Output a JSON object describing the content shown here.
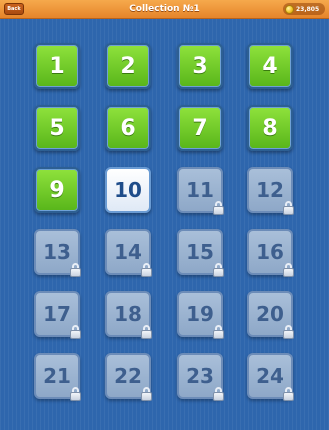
{
  "header": {
    "back_label": "Back",
    "title": "Collection №1",
    "coins": "23,805",
    "coin_icon": "coin-icon"
  },
  "levels": [
    {
      "number": "1",
      "state": "unlocked"
    },
    {
      "number": "2",
      "state": "unlocked"
    },
    {
      "number": "3",
      "state": "unlocked"
    },
    {
      "number": "4",
      "state": "unlocked"
    },
    {
      "number": "5",
      "state": "unlocked"
    },
    {
      "number": "6",
      "state": "unlocked"
    },
    {
      "number": "7",
      "state": "unlocked"
    },
    {
      "number": "8",
      "state": "unlocked"
    },
    {
      "number": "9",
      "state": "unlocked"
    },
    {
      "number": "10",
      "state": "current"
    },
    {
      "number": "11",
      "state": "locked"
    },
    {
      "number": "12",
      "state": "locked"
    },
    {
      "number": "13",
      "state": "locked"
    },
    {
      "number": "14",
      "state": "locked"
    },
    {
      "number": "15",
      "state": "locked"
    },
    {
      "number": "16",
      "state": "locked"
    },
    {
      "number": "17",
      "state": "locked"
    },
    {
      "number": "18",
      "state": "locked"
    },
    {
      "number": "19",
      "state": "locked"
    },
    {
      "number": "20",
      "state": "locked"
    },
    {
      "number": "21",
      "state": "locked"
    },
    {
      "number": "22",
      "state": "locked"
    },
    {
      "number": "23",
      "state": "locked"
    },
    {
      "number": "24",
      "state": "locked"
    }
  ],
  "colors": {
    "background": "#2e66ad",
    "header": "#f6a94c",
    "unlocked": "#7ad12e",
    "current": "#ffffff",
    "locked": "#9db5d2"
  }
}
